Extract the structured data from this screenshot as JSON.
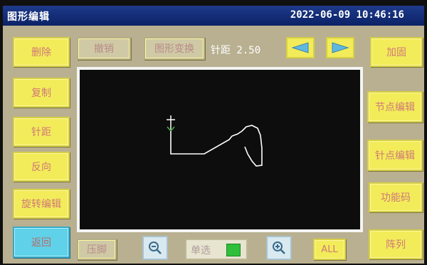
{
  "header": {
    "title": "图形编辑",
    "datetime": "2022-06-09 10:46:16"
  },
  "left_buttons": [
    {
      "label": "删除"
    },
    {
      "label": "复制"
    },
    {
      "label": "针距"
    },
    {
      "label": "反向"
    },
    {
      "label": "旋转编辑"
    },
    {
      "label": "返回"
    }
  ],
  "right_buttons": [
    {
      "label": "加固"
    },
    {
      "label": "节点编辑"
    },
    {
      "label": "针点编辑"
    },
    {
      "label": "功能码"
    },
    {
      "label": "阵列"
    }
  ],
  "toolbar": {
    "undo_label": "撤销",
    "transform_label": "图形变换",
    "stitch_pitch_label": "针距 2.50",
    "prev_icon": "arrow-left-icon",
    "next_icon": "arrow-right-icon"
  },
  "bottom_bar": {
    "presser_foot_label": "压脚",
    "zoom_out_icon": "zoom-out-icon",
    "select_label": "单选",
    "zoom_in_icon": "zoom-in-icon",
    "all_label": "ALL"
  },
  "colors": {
    "button": "#f2ec5a",
    "active_button": "#5fd1e8",
    "titlebar": "#1e3a8a",
    "canvas": "#0d0d0d",
    "stroke": "#ffffff",
    "origin_marker": "#4caf50"
  }
}
